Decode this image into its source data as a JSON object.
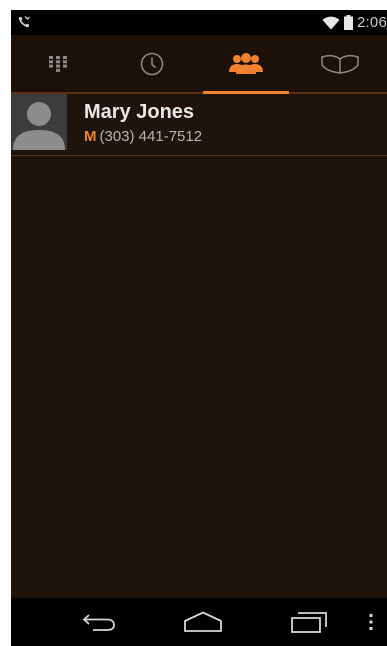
{
  "status_bar": {
    "left_icon": "missed-call-icon",
    "wifi_icon": "wifi-icon",
    "battery_icon": "battery-icon",
    "time": "2:06"
  },
  "tabs": [
    {
      "name": "dialpad",
      "icon": "dialpad-icon",
      "active": false
    },
    {
      "name": "recents",
      "icon": "clock-icon",
      "active": false
    },
    {
      "name": "contacts",
      "icon": "people-icon",
      "active": true
    },
    {
      "name": "favorites",
      "icon": "open-book-icon",
      "active": false
    }
  ],
  "contacts": [
    {
      "name": "Mary Jones",
      "phone_type": "M",
      "phone": "(303) 441-7512",
      "avatar": "default-person-avatar"
    }
  ],
  "nav_bar": {
    "back_icon": "back-icon",
    "home_icon": "home-icon",
    "recents_icon": "recent-apps-icon",
    "menu_icon": "overflow-menu-icon"
  },
  "colors": {
    "accent": "#f0822f",
    "background": "#1f140b",
    "divider": "#5a2f12"
  }
}
